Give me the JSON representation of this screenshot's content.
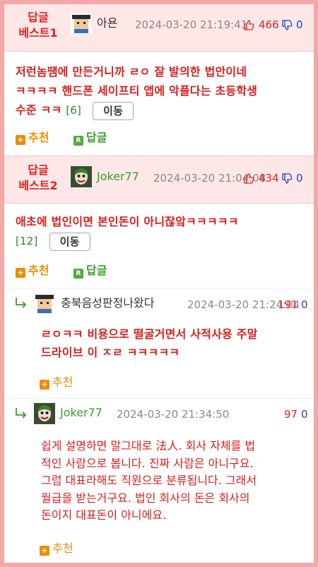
{
  "comments": [
    {
      "badge": "답글\n베스트1",
      "badge_line1": "답글",
      "badge_line2": "베스트1",
      "author": "아욘",
      "date": "2024-03-20 21:19:41",
      "likes": "466",
      "dislikes": "0",
      "text_line1": "저런놈땜에 만든거니까 ㄹㅇ 잘 발의한 법안이네",
      "text_line2": "ㅋㅋㅋㅋ 핸드폰 세이프티 앱에 악플다는 초등학생",
      "text_line3": "수준 ㅋㅋ",
      "count": "[6]",
      "move_label": "이동",
      "recommend_label": "추천",
      "reply_label": "답글"
    },
    {
      "badge_line1": "답글",
      "badge_line2": "베스트2",
      "author": "Joker77",
      "date": "2024-03-20 21:04:08",
      "likes": "434",
      "dislikes": "0",
      "text_line1": "애초에 법인이면 본인돈이 아니잖앜ㅋㅋㅋㅋㅋ",
      "count": "[12]",
      "move_label": "이동",
      "recommend_label": "추천",
      "reply_label": "답글"
    }
  ],
  "replies": [
    {
      "author": "충북음성판정나왔다",
      "date": "2024-03-20 21:24:04",
      "likes": "191",
      "dislikes": "0",
      "text_line1": "ㄹㅇㅋㅋ 비용으로 떨굴거면서 사적사용 주말",
      "text_line2": "드라이브 이 ㅈㄹ ㅋㅋㅋㅋㅋ",
      "recommend_label": "추천"
    },
    {
      "author": "Joker77",
      "date": "2024-03-20 21:34:50",
      "likes": "97",
      "dislikes": "0",
      "text_line1": "쉽게 설명하면 말그대로 法人. 회사 자체를 법",
      "text_line2": "적인 사람으로 봅니다. 진짜 사람은 아니구요.",
      "text_line3": "그럼 대표라해도 직원으로 분류됩니다. 그래서",
      "text_line4": "월급을 받는거구요. 법인 회사의 돈은 회사의",
      "text_line5": "돈이지 대표돈이 아니에요.",
      "recommend_label": "추천"
    }
  ],
  "colors": {
    "accent_red": "#e02424",
    "border_pink": "#f4a7a7",
    "header_bg": "#fde7e7",
    "recommend_orange": "#f08c00",
    "reply_green": "#3b9d2b",
    "dislike_blue": "#2040d0"
  }
}
